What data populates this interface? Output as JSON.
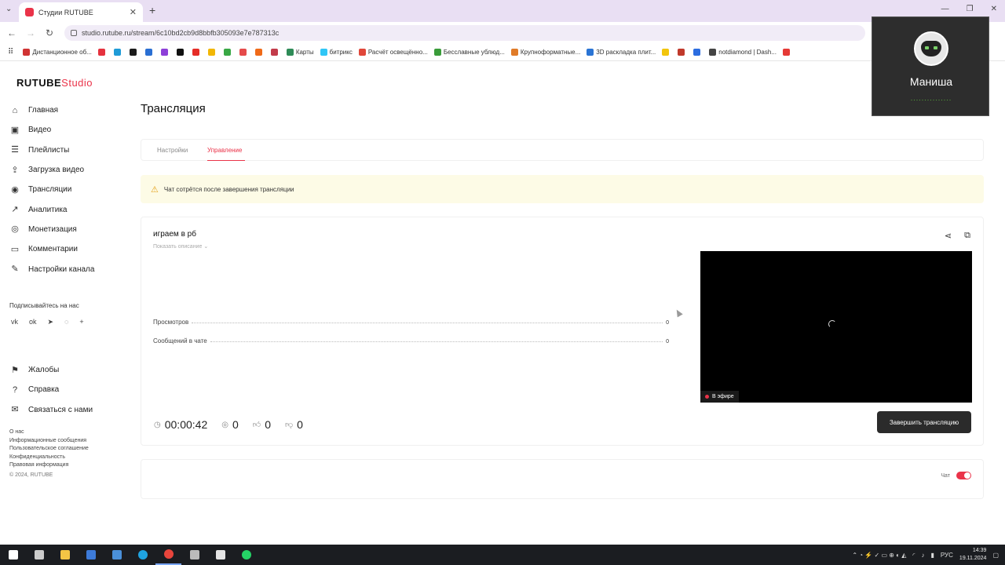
{
  "browser": {
    "tab_title": "Студии RUTUBE",
    "tab_close": "✕",
    "new_tab": "+",
    "url": "studio.rutube.ru/stream/6c10bd2cb9d8bbfb305093e7e787313c",
    "bookmarks": [
      {
        "label": "Дистанционное об...",
        "color": "#d03333"
      },
      {
        "label": "",
        "color": "#e5323e"
      },
      {
        "label": "",
        "color": "#1f9bd7"
      },
      {
        "label": "",
        "color": "#1b1b1b"
      },
      {
        "label": "",
        "color": "#2a6fd3"
      },
      {
        "label": "",
        "color": "#8d3fd8"
      },
      {
        "label": "",
        "color": "#111111"
      },
      {
        "label": "",
        "color": "#e52d27"
      },
      {
        "label": "",
        "color": "#f2b705"
      },
      {
        "label": "",
        "color": "#39a845"
      },
      {
        "label": "",
        "color": "#e54b4b"
      },
      {
        "label": "",
        "color": "#f06a18"
      },
      {
        "label": "",
        "color": "#c23b4a"
      },
      {
        "label": "Карты",
        "color": "#2e8b57"
      },
      {
        "label": "битрикс",
        "color": "#2fc6f6"
      },
      {
        "label": "Расчёт освещённо...",
        "color": "#e0473a"
      },
      {
        "label": "Бесславные ублюд...",
        "color": "#3a9c3a"
      },
      {
        "label": "Крупноформатные...",
        "color": "#e07b28"
      },
      {
        "label": "3D раскладка плит...",
        "color": "#2a74d4"
      },
      {
        "label": "",
        "color": "#f2c50c"
      },
      {
        "label": "",
        "color": "#c0392b"
      },
      {
        "label": "",
        "color": "#2c6de0"
      },
      {
        "label": "notdiamond | Dash...",
        "color": "#444444"
      },
      {
        "label": "",
        "color": "#e53935"
      }
    ]
  },
  "sidebar": {
    "logo_main": "RUTUBE",
    "logo_sub": "Studio",
    "items": [
      {
        "label": "Главная",
        "icon": "home-icon",
        "glyph": "⌂"
      },
      {
        "label": "Видео",
        "icon": "video-icon",
        "glyph": "▣"
      },
      {
        "label": "Плейлисты",
        "icon": "playlist-icon",
        "glyph": "☰"
      },
      {
        "label": "Загрузка видео",
        "icon": "upload-icon",
        "glyph": "⇪"
      },
      {
        "label": "Трансляции",
        "icon": "broadcast-icon",
        "glyph": "◉"
      },
      {
        "label": "Аналитика",
        "icon": "analytics-icon",
        "glyph": "↗"
      },
      {
        "label": "Монетизация",
        "icon": "monetization-icon",
        "glyph": "◎"
      },
      {
        "label": "Комментарии",
        "icon": "comments-icon",
        "glyph": "▭"
      },
      {
        "label": "Настройки канала",
        "icon": "settings-icon",
        "glyph": "✎"
      }
    ],
    "subscribe_label": "Подписывайтесь на нас",
    "socials": [
      {
        "glyph": "vk",
        "icon": "vk-icon"
      },
      {
        "glyph": "ok",
        "icon": "ok-icon"
      },
      {
        "glyph": "➤",
        "icon": "telegram-icon"
      },
      {
        "glyph": "◌",
        "icon": "viber-icon"
      },
      {
        "glyph": "+",
        "icon": "more-icon"
      }
    ],
    "items2": [
      {
        "label": "Жалобы",
        "icon": "complaints-icon",
        "glyph": "⚑"
      },
      {
        "label": "Справка",
        "icon": "help-icon",
        "glyph": "?"
      },
      {
        "label": "Связаться с нами",
        "icon": "contact-icon",
        "glyph": "✉"
      }
    ],
    "footer": [
      "О нас",
      "Информационные сообщения",
      "Пользовательское соглашение",
      "Конфиденциальность",
      "Правовая информация"
    ],
    "copyright": "© 2024, RUTUBE"
  },
  "main": {
    "title": "Трансляция",
    "tabs": [
      {
        "label": "Настройки",
        "active": false
      },
      {
        "label": "Управление",
        "active": true
      }
    ],
    "notice": "Чат сотрётся после завершения трансляции",
    "stream": {
      "title": "играем в рб",
      "show_description": "Показать описание",
      "stats": [
        {
          "label": "Просмотров",
          "value": "0"
        },
        {
          "label": "Сообщений в чате",
          "value": "0"
        }
      ],
      "live_label": "В эфире",
      "duration": "00:00:42",
      "viewers": "0",
      "likes": "0",
      "dislikes": "0",
      "end_button": "Завершить трансляцию"
    },
    "chat_label": "Чат",
    "chat_enabled": true
  },
  "call_overlay": {
    "name": "Маниша",
    "status_dots": "..............."
  },
  "taskbar": {
    "lang": "РУС",
    "time": "14:39",
    "date": "19.11.2024",
    "apps": [
      {
        "icon": "windows-start-icon",
        "color": "#ffffff"
      },
      {
        "icon": "task-view-icon",
        "color": "#cccccc"
      },
      {
        "icon": "file-explorer-icon",
        "color": "#f3c545"
      },
      {
        "icon": "app-icon",
        "color": "#3d7bd9"
      },
      {
        "icon": "calculator-icon",
        "color": "#4a90d9"
      },
      {
        "icon": "edge-icon",
        "color": "#1fa3e0"
      },
      {
        "icon": "chrome-icon",
        "color": "#e8453c"
      },
      {
        "icon": "app-icon-2",
        "color": "#bbbbbb"
      },
      {
        "icon": "app-icon-3",
        "color": "#e5e5e5"
      },
      {
        "icon": "whatsapp-icon",
        "color": "#25d366"
      }
    ]
  }
}
